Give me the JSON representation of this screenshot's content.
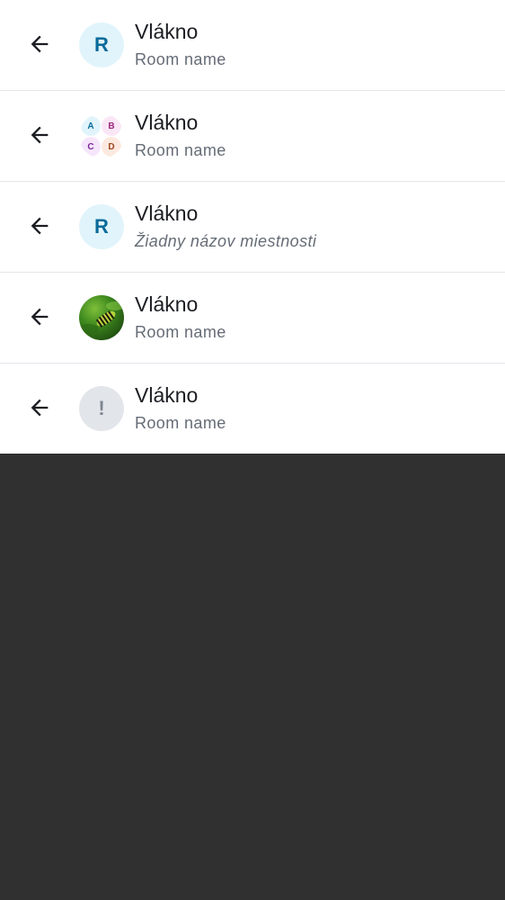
{
  "colors": {
    "background_dark": "#303030",
    "row_background": "#ffffff",
    "divider": "#e4e6ea",
    "title_text": "#1b1d22",
    "subtitle_text": "#656c76",
    "letter_avatar_bg": "#e1f4fb",
    "letter_avatar_fg": "#0a6b9a",
    "error_avatar_bg": "#e2e5ea",
    "error_avatar_fg": "#7e8591"
  },
  "rows": [
    {
      "back_icon": "arrow-left-icon",
      "avatar_type": "letter",
      "avatar_letter": "R",
      "title": "Vlákno",
      "subtitle": "Room name"
    },
    {
      "back_icon": "arrow-left-icon",
      "avatar_type": "cluster",
      "cluster_letters": [
        {
          "letter": "A",
          "bg": "#e1f4fb",
          "fg": "#0a6b9a"
        },
        {
          "letter": "B",
          "bg": "#fbe6f6",
          "fg": "#9b2a7e"
        },
        {
          "letter": "C",
          "bg": "#f6e6fb",
          "fg": "#7a2a9b"
        },
        {
          "letter": "D",
          "bg": "#fde9df",
          "fg": "#a3441c"
        }
      ],
      "title": "Vlákno",
      "subtitle": "Room name"
    },
    {
      "back_icon": "arrow-left-icon",
      "avatar_type": "letter",
      "avatar_letter": "R",
      "title": "Vlákno",
      "subtitle": "Žiadny názov miestnosti",
      "subtitle_italic": true
    },
    {
      "back_icon": "arrow-left-icon",
      "avatar_type": "image",
      "avatar_image": "caterpillar-photo",
      "title": "Vlákno",
      "subtitle": "Room name"
    },
    {
      "back_icon": "arrow-left-icon",
      "avatar_type": "error",
      "avatar_letter": "!",
      "title": "Vlákno",
      "subtitle": "Room name"
    }
  ]
}
